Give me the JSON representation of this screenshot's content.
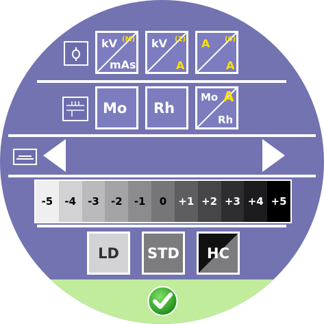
{
  "colors": {
    "background": "#7373b2",
    "border": "#ffffff",
    "highlight_text": "#ffe000",
    "confirm_bar": "#c0ec9b",
    "confirm_button": "#36b22a"
  },
  "row1": {
    "icon": "exposure-control-icon",
    "kv_mas": {
      "top": "kV",
      "tag": "(M)",
      "bottom": "mAs"
    },
    "kv_a": {
      "top": "kV",
      "tag": "(1)",
      "bottom": "A"
    },
    "a_a": {
      "top": "A",
      "tag": "(0)",
      "bottom": "A"
    }
  },
  "row2": {
    "icon": "filter-track-icon",
    "mo": "Mo",
    "rh": "Rh",
    "auto": {
      "top": "Mo",
      "mark": "A",
      "bottom": "Rh"
    }
  },
  "row3": {
    "icon": "compression-plate-icon",
    "prev": "left-arrow-icon",
    "next": "right-arrow-icon"
  },
  "density_scale": {
    "labels": [
      "-5",
      "-4",
      "-3",
      "-2",
      "-1",
      "0",
      "+1",
      "+2",
      "+3",
      "+4",
      "+5"
    ],
    "fills": [
      "#efeff0",
      "#d2d2d4",
      "#bababc",
      "#a4a4a6",
      "#8c8c8e",
      "#767678",
      "#5e5e60",
      "#464648",
      "#2e2e30",
      "#1c1c1e",
      "#000000"
    ],
    "text_colors": [
      "#000000",
      "#000000",
      "#000000",
      "#000000",
      "#000000",
      "#000000",
      "#ffffff",
      "#ffffff",
      "#ffffff",
      "#ffffff",
      "#ffffff"
    ]
  },
  "modes": {
    "ld": "LD",
    "std": "STD",
    "hc": "HC"
  },
  "confirm": {
    "icon": "checkmark-icon"
  }
}
